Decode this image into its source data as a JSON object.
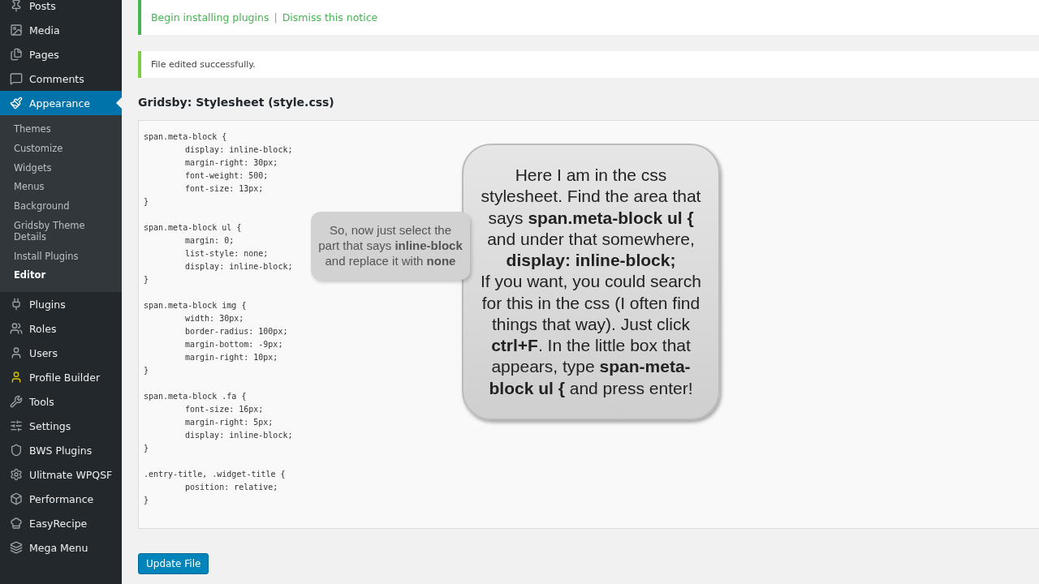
{
  "sidebar": {
    "items": [
      {
        "label": "Posts",
        "selected": false
      },
      {
        "label": "Media",
        "selected": false
      },
      {
        "label": "Pages",
        "selected": false
      },
      {
        "label": "Comments",
        "selected": false
      },
      {
        "label": "Appearance",
        "selected": true,
        "children": [
          {
            "label": "Themes",
            "selected": false
          },
          {
            "label": "Customize",
            "selected": false
          },
          {
            "label": "Widgets",
            "selected": false
          },
          {
            "label": "Menus",
            "selected": false
          },
          {
            "label": "Background",
            "selected": false
          },
          {
            "label": "Gridsby Theme Details",
            "selected": false
          },
          {
            "label": "Install Plugins",
            "selected": false
          },
          {
            "label": "Editor",
            "selected": true
          }
        ]
      },
      {
        "label": "Plugins",
        "selected": false
      },
      {
        "label": "Roles",
        "selected": false
      },
      {
        "label": "Users",
        "selected": false
      },
      {
        "label": "Profile Builder",
        "selected": false
      },
      {
        "label": "Tools",
        "selected": false
      },
      {
        "label": "Settings",
        "selected": false
      },
      {
        "label": "BWS Plugins",
        "selected": false
      },
      {
        "label": "Ulitmate WPQSF",
        "selected": false
      },
      {
        "label": "Performance",
        "selected": false
      },
      {
        "label": "EasyRecipe",
        "selected": false
      },
      {
        "label": "Mega Menu",
        "selected": false
      }
    ]
  },
  "notices": [
    {
      "kind": "plugins",
      "links": [
        "Begin installing plugins",
        "Dismiss this notice"
      ],
      "separator": "|"
    },
    {
      "kind": "success",
      "text": "File edited successfully."
    }
  ],
  "editor": {
    "title": "Gridsby: Stylesheet (style.css)",
    "code": [
      {
        "selector": "span.meta-block {",
        "lines": [
          "display: inline-block;",
          "margin-right: 30px;",
          "font-weight: 500;",
          "font-size: 13px;"
        ],
        "close": "}"
      },
      {
        "selector": "span.meta-block ul {",
        "lines": [
          "margin: 0;",
          "list-style: none;",
          "display: inline-block;"
        ],
        "close": "}"
      },
      {
        "selector": "span.meta-block img {",
        "lines": [
          "width: 30px;",
          "border-radius: 100px;",
          "margin-bottom: -9px;",
          "margin-right: 10px;"
        ],
        "close": "}"
      },
      {
        "selector": "span.meta-block .fa {",
        "lines": [
          "font-size: 16px;",
          "margin-right: 5px;",
          "display: inline-block;"
        ],
        "close": "}"
      },
      {
        "selector": ".entry-title, .widget-title {",
        "lines": [
          "position: relative;"
        ],
        "close": "}"
      }
    ],
    "button": "Update File"
  },
  "callouts": [
    {
      "kind": "main",
      "paragraphs": [
        "Here I am in the css stylesheet. Find the area that says **span.meta-block ul {** and under that somewhere, **display: inline-block;**",
        "If you want, you could search for this in the css (I often find things that way). Just click **ctrl+F**. In the little box that appears, type **span-meta-block ul {** and press enter!"
      ]
    },
    {
      "kind": "faded",
      "paragraphs": [
        "So, now just select the part that says **inline-block** and replace it with **none**"
      ]
    }
  ]
}
